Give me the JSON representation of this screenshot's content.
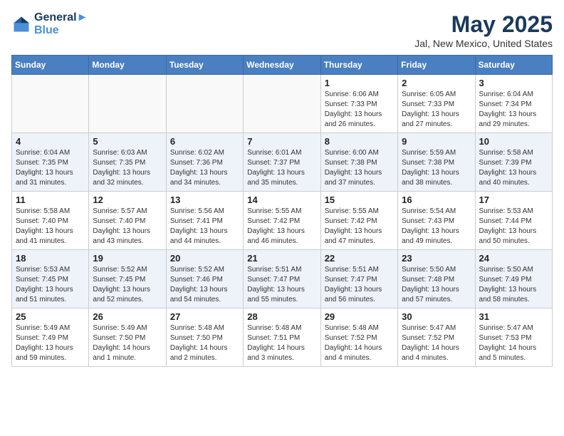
{
  "logo": {
    "line1": "General",
    "line2": "Blue"
  },
  "title": "May 2025",
  "location": "Jal, New Mexico, United States",
  "weekdays": [
    "Sunday",
    "Monday",
    "Tuesday",
    "Wednesday",
    "Thursday",
    "Friday",
    "Saturday"
  ],
  "weeks": [
    [
      {
        "day": "",
        "info": ""
      },
      {
        "day": "",
        "info": ""
      },
      {
        "day": "",
        "info": ""
      },
      {
        "day": "",
        "info": ""
      },
      {
        "day": "1",
        "info": "Sunrise: 6:06 AM\nSunset: 7:33 PM\nDaylight: 13 hours and 26 minutes."
      },
      {
        "day": "2",
        "info": "Sunrise: 6:05 AM\nSunset: 7:33 PM\nDaylight: 13 hours and 27 minutes."
      },
      {
        "day": "3",
        "info": "Sunrise: 6:04 AM\nSunset: 7:34 PM\nDaylight: 13 hours and 29 minutes."
      }
    ],
    [
      {
        "day": "4",
        "info": "Sunrise: 6:04 AM\nSunset: 7:35 PM\nDaylight: 13 hours and 31 minutes."
      },
      {
        "day": "5",
        "info": "Sunrise: 6:03 AM\nSunset: 7:35 PM\nDaylight: 13 hours and 32 minutes."
      },
      {
        "day": "6",
        "info": "Sunrise: 6:02 AM\nSunset: 7:36 PM\nDaylight: 13 hours and 34 minutes."
      },
      {
        "day": "7",
        "info": "Sunrise: 6:01 AM\nSunset: 7:37 PM\nDaylight: 13 hours and 35 minutes."
      },
      {
        "day": "8",
        "info": "Sunrise: 6:00 AM\nSunset: 7:38 PM\nDaylight: 13 hours and 37 minutes."
      },
      {
        "day": "9",
        "info": "Sunrise: 5:59 AM\nSunset: 7:38 PM\nDaylight: 13 hours and 38 minutes."
      },
      {
        "day": "10",
        "info": "Sunrise: 5:58 AM\nSunset: 7:39 PM\nDaylight: 13 hours and 40 minutes."
      }
    ],
    [
      {
        "day": "11",
        "info": "Sunrise: 5:58 AM\nSunset: 7:40 PM\nDaylight: 13 hours and 41 minutes."
      },
      {
        "day": "12",
        "info": "Sunrise: 5:57 AM\nSunset: 7:40 PM\nDaylight: 13 hours and 43 minutes."
      },
      {
        "day": "13",
        "info": "Sunrise: 5:56 AM\nSunset: 7:41 PM\nDaylight: 13 hours and 44 minutes."
      },
      {
        "day": "14",
        "info": "Sunrise: 5:55 AM\nSunset: 7:42 PM\nDaylight: 13 hours and 46 minutes."
      },
      {
        "day": "15",
        "info": "Sunrise: 5:55 AM\nSunset: 7:42 PM\nDaylight: 13 hours and 47 minutes."
      },
      {
        "day": "16",
        "info": "Sunrise: 5:54 AM\nSunset: 7:43 PM\nDaylight: 13 hours and 49 minutes."
      },
      {
        "day": "17",
        "info": "Sunrise: 5:53 AM\nSunset: 7:44 PM\nDaylight: 13 hours and 50 minutes."
      }
    ],
    [
      {
        "day": "18",
        "info": "Sunrise: 5:53 AM\nSunset: 7:45 PM\nDaylight: 13 hours and 51 minutes."
      },
      {
        "day": "19",
        "info": "Sunrise: 5:52 AM\nSunset: 7:45 PM\nDaylight: 13 hours and 52 minutes."
      },
      {
        "day": "20",
        "info": "Sunrise: 5:52 AM\nSunset: 7:46 PM\nDaylight: 13 hours and 54 minutes."
      },
      {
        "day": "21",
        "info": "Sunrise: 5:51 AM\nSunset: 7:47 PM\nDaylight: 13 hours and 55 minutes."
      },
      {
        "day": "22",
        "info": "Sunrise: 5:51 AM\nSunset: 7:47 PM\nDaylight: 13 hours and 56 minutes."
      },
      {
        "day": "23",
        "info": "Sunrise: 5:50 AM\nSunset: 7:48 PM\nDaylight: 13 hours and 57 minutes."
      },
      {
        "day": "24",
        "info": "Sunrise: 5:50 AM\nSunset: 7:49 PM\nDaylight: 13 hours and 58 minutes."
      }
    ],
    [
      {
        "day": "25",
        "info": "Sunrise: 5:49 AM\nSunset: 7:49 PM\nDaylight: 13 hours and 59 minutes."
      },
      {
        "day": "26",
        "info": "Sunrise: 5:49 AM\nSunset: 7:50 PM\nDaylight: 14 hours and 1 minute."
      },
      {
        "day": "27",
        "info": "Sunrise: 5:48 AM\nSunset: 7:50 PM\nDaylight: 14 hours and 2 minutes."
      },
      {
        "day": "28",
        "info": "Sunrise: 5:48 AM\nSunset: 7:51 PM\nDaylight: 14 hours and 3 minutes."
      },
      {
        "day": "29",
        "info": "Sunrise: 5:48 AM\nSunset: 7:52 PM\nDaylight: 14 hours and 4 minutes."
      },
      {
        "day": "30",
        "info": "Sunrise: 5:47 AM\nSunset: 7:52 PM\nDaylight: 14 hours and 4 minutes."
      },
      {
        "day": "31",
        "info": "Sunrise: 5:47 AM\nSunset: 7:53 PM\nDaylight: 14 hours and 5 minutes."
      }
    ]
  ]
}
